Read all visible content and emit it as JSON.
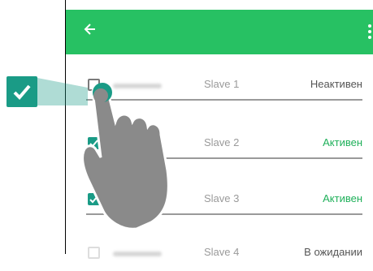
{
  "appbar": {
    "color": "#27c163",
    "back_icon": "arrow-left-icon",
    "menu_icon": "more-vertical-icon"
  },
  "rows": [
    {
      "slave": "Slave 1",
      "status": "Неактивен",
      "checked": false,
      "active": false
    },
    {
      "slave": "Slave 2",
      "status": "Активен",
      "checked": true,
      "active": true
    },
    {
      "slave": "Slave 3",
      "status": "Активен",
      "checked": true,
      "active": true
    },
    {
      "slave": "Slave 4",
      "status": "В ожидании",
      "checked": false,
      "active": false
    }
  ],
  "callout": {
    "icon": "check-icon",
    "color": "#1a9b86"
  },
  "overlay": {
    "icon": "tap-hand-icon"
  }
}
